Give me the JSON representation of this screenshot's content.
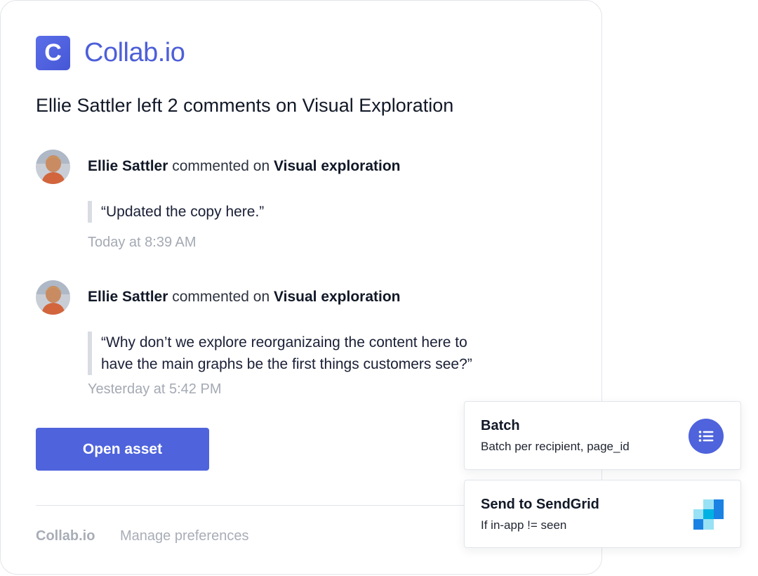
{
  "brand": {
    "logo_letter": "C",
    "name": "Collab.io",
    "color": "#4d5fd8"
  },
  "headline": "Ellie Sattler left 2 comments on Visual Exploration",
  "comments": [
    {
      "author": "Ellie Sattler",
      "action": "commented on",
      "target": "Visual exploration",
      "quote": "“Updated the copy here.”",
      "time": "Today at 8:39 AM"
    },
    {
      "author": "Ellie Sattler",
      "action": "commented on",
      "target": "Visual exploration",
      "quote_lines": [
        "“Why don’t we explore reorganizaing the content here to",
        "have the main graphs be the first things customers see?”"
      ],
      "time": "Yesterday at 5:42 PM"
    }
  ],
  "cta": {
    "label": "Open asset",
    "color": "#4e63dc"
  },
  "footer": {
    "brand": "Collab.io",
    "link": "Manage preferences"
  },
  "workflow": [
    {
      "title": "Batch",
      "subtitle": "Batch per recipient, page_id",
      "icon": "list-icon"
    },
    {
      "title": "Send to SendGrid",
      "subtitle": "If in-app != seen",
      "icon": "sendgrid-logo"
    }
  ]
}
